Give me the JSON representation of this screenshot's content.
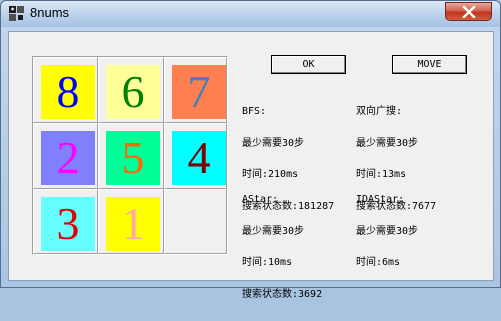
{
  "window": {
    "title": "8nums",
    "app_icon": "puzzle-app-icon",
    "close_icon": "close-icon"
  },
  "buttons": {
    "ok_label": "OK",
    "move_label": "MOVE"
  },
  "board": {
    "tiles": [
      {
        "value": "8",
        "bg": "#ffff00",
        "fg": "#0000ff"
      },
      {
        "value": "6",
        "bg": "#ffff99",
        "fg": "#008000"
      },
      {
        "value": "7",
        "bg": "#ff7f50",
        "fg": "#4682b4"
      },
      {
        "value": "2",
        "bg": "#8080ff",
        "fg": "#ff00ff"
      },
      {
        "value": "5",
        "bg": "#00ff99",
        "fg": "#ff6600"
      },
      {
        "value": "4",
        "bg": "#00ffff",
        "fg": "#800000"
      },
      {
        "value": "3",
        "bg": "#66ffff",
        "fg": "#e00000"
      },
      {
        "value": "1",
        "bg": "#ffff00",
        "fg": "#ffaaaa"
      },
      null
    ]
  },
  "results": {
    "bfs": {
      "name": "BFS:",
      "min_steps": "最少需要30步",
      "time": "时间:210ms",
      "states": "搜索状态数:181287"
    },
    "bidirectional": {
      "name": "双向广搜:",
      "min_steps": "最少需要30步",
      "time": "时间:13ms",
      "states": "搜索状态数:7677"
    },
    "astar": {
      "name": "AStar:",
      "min_steps": "最少需要30步",
      "time": "时间:10ms",
      "states": "搜索状态数:3692"
    },
    "idastar": {
      "name": "IDAStar:",
      "min_steps": "最少需要30步",
      "time": "时间:6ms",
      "states": ""
    }
  }
}
